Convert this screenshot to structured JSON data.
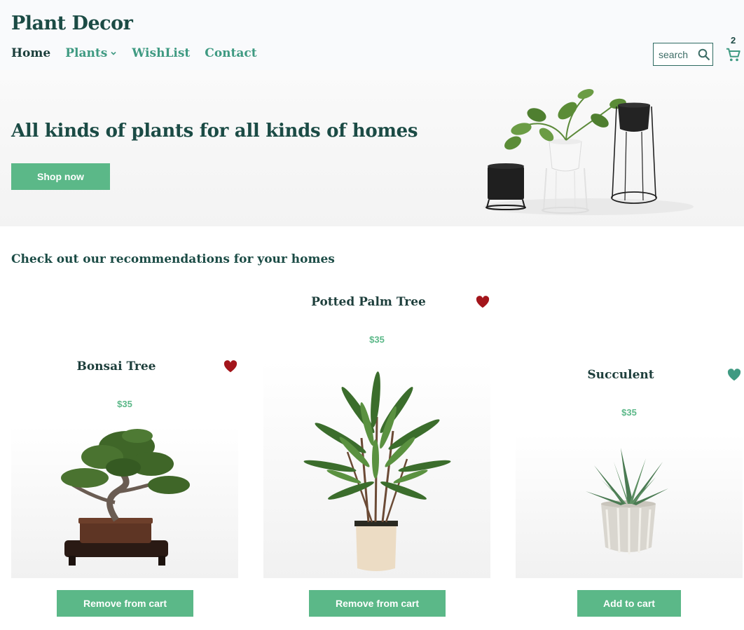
{
  "header": {
    "logo": "Plant Decor",
    "nav": [
      {
        "label": "Home",
        "active": true
      },
      {
        "label": "Plants",
        "dropdown": true
      },
      {
        "label": "WishList"
      },
      {
        "label": "Contact"
      }
    ],
    "search": {
      "placeholder": "search",
      "icon": "search-icon"
    },
    "cart": {
      "count": "2",
      "icon": "cart-icon"
    }
  },
  "hero": {
    "title": "All kinds of plants for all kinds of homes",
    "cta": "Shop now"
  },
  "recommendations": {
    "title": "Check out our recommendations for your homes",
    "products": [
      {
        "name": "Bonsai Tree",
        "price": "$35",
        "wishlisted": true,
        "button": "Remove from cart"
      },
      {
        "name": "Potted Palm Tree",
        "price": "$35",
        "wishlisted": true,
        "button": "Remove from cart"
      },
      {
        "name": "Succulent",
        "price": "$35",
        "wishlisted": false,
        "button": "Add to cart"
      }
    ]
  },
  "colors": {
    "primary_dark": "#1b4b45",
    "accent_green": "#5bb888",
    "heart_active": "#a3151b",
    "heart_inactive": "#3f9a82"
  }
}
